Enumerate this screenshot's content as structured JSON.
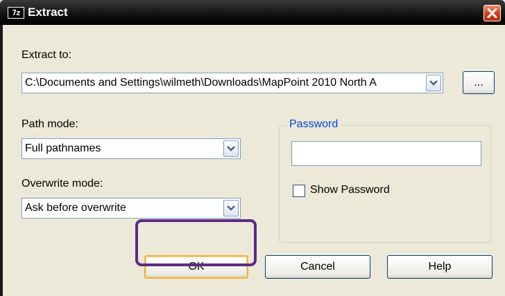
{
  "window": {
    "title": "Extract",
    "app_icon_text": "7z"
  },
  "extract_to": {
    "label": "Extract to:",
    "value": "C:\\Documents and Settings\\wilmeth\\Downloads\\MapPoint 2010 North A",
    "browse_label": "..."
  },
  "path_mode": {
    "label": "Path mode:",
    "value": "Full pathnames"
  },
  "overwrite_mode": {
    "label": "Overwrite mode:",
    "value": "Ask before overwrite"
  },
  "password": {
    "group_label": "Password",
    "value": "",
    "show_password_label": "Show Password",
    "show_password_checked": false
  },
  "buttons": {
    "ok": "OK",
    "cancel": "Cancel",
    "help": "Help"
  },
  "colors": {
    "titlebar": "#111111",
    "dialog_bg": "#ece9d8",
    "close_button": "#d8401c",
    "group_label": "#0046d5",
    "highlight": "#5b2a86"
  }
}
